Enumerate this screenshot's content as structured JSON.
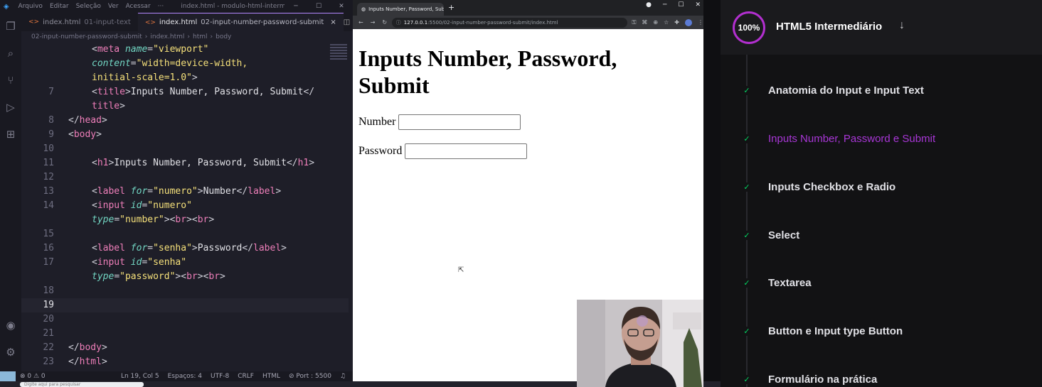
{
  "vscode": {
    "menu": [
      "Arquivo",
      "Editar",
      "Seleção",
      "Ver",
      "Acessar",
      "···"
    ],
    "window_title": "index.html - modulo-html-intermedi...",
    "tabs": [
      {
        "name": "index.html",
        "sub": "01-input-text",
        "active": false
      },
      {
        "name": "index.html",
        "sub": "02-input-number-password-submit",
        "active": true,
        "close": "×"
      }
    ],
    "breadcrumb": [
      "02-input-number-password-submit",
      "›",
      "index.html",
      "›",
      "html",
      "›",
      "body"
    ],
    "lines": [
      {
        "n": "",
        "html": "<span class='pu'>&lt;</span><span class='tg'>meta</span> <span class='at'>name</span><span class='pu'>=</span><span class='st'>\"viewport\"</span>"
      },
      {
        "n": "",
        "html": "<span class='at'>content</span><span class='pu'>=</span><span class='st'>\"width=device-width,</span>"
      },
      {
        "n": "",
        "html": "<span class='st'>initial-scale=1.0\"</span><span class='pu'>&gt;</span>"
      },
      {
        "n": "7",
        "html": "<span class='pu'>&lt;</span><span class='tg'>title</span><span class='pu'>&gt;</span><span class='t'>Inputs Number, Password, Submit</span><span class='pu'>&lt;/</span>"
      },
      {
        "n": "",
        "html": "<span class='tg'>title</span><span class='pu'>&gt;</span>"
      },
      {
        "n": "8",
        "html": "<span class='pu'>&lt;/</span><span class='tg'>head</span><span class='pu'>&gt;</span>"
      },
      {
        "n": "9",
        "html": "<span class='pu'>&lt;</span><span class='tg'>body</span><span class='pu'>&gt;</span>"
      },
      {
        "n": "10",
        "html": ""
      },
      {
        "n": "11",
        "html": "<span class='pu'>&lt;</span><span class='tg'>h1</span><span class='pu'>&gt;</span><span class='t'>Inputs Number, Password, Submit</span><span class='pu'>&lt;/</span><span class='tg'>h1</span><span class='pu'>&gt;</span>"
      },
      {
        "n": "12",
        "html": ""
      },
      {
        "n": "13",
        "html": "<span class='pu'>&lt;</span><span class='tg'>label</span> <span class='at'>for</span><span class='pu'>=</span><span class='st'>\"numero\"</span><span class='pu'>&gt;</span><span class='t'>Number</span><span class='pu'>&lt;/</span><span class='tg'>label</span><span class='pu'>&gt;</span>"
      },
      {
        "n": "14",
        "html": "<span class='pu'>&lt;</span><span class='tg'>input</span> <span class='at'>id</span><span class='pu'>=</span><span class='st'>\"numero\"</span>"
      },
      {
        "n": "",
        "html": "<span class='at'>type</span><span class='pu'>=</span><span class='st'>\"number\"</span><span class='pu'>&gt;&lt;</span><span class='tg'>br</span><span class='pu'>&gt;&lt;</span><span class='tg'>br</span><span class='pu'>&gt;</span>"
      },
      {
        "n": "15",
        "html": ""
      },
      {
        "n": "16",
        "html": "<span class='pu'>&lt;</span><span class='tg'>label</span> <span class='at'>for</span><span class='pu'>=</span><span class='st'>\"senha\"</span><span class='pu'>&gt;</span><span class='t'>Password</span><span class='pu'>&lt;/</span><span class='tg'>label</span><span class='pu'>&gt;</span>"
      },
      {
        "n": "17",
        "html": "<span class='pu'>&lt;</span><span class='tg'>input</span> <span class='at'>id</span><span class='pu'>=</span><span class='st'>\"senha\"</span>"
      },
      {
        "n": "",
        "html": "<span class='at'>type</span><span class='pu'>=</span><span class='st'>\"password\"</span><span class='pu'>&gt;&lt;</span><span class='tg'>br</span><span class='pu'>&gt;&lt;</span><span class='tg'>br</span><span class='pu'>&gt;</span>"
      },
      {
        "n": "18",
        "html": ""
      },
      {
        "n": "19",
        "html": "",
        "current": true
      },
      {
        "n": "20",
        "html": ""
      },
      {
        "n": "21",
        "html": ""
      },
      {
        "n": "22",
        "html": "<span class='pu'>&lt;/</span><span class='tg'>body</span><span class='pu'>&gt;</span>"
      },
      {
        "n": "23",
        "html": "<span class='pu'>&lt;/</span><span class='tg'>html</span><span class='pu'>&gt;</span>"
      }
    ],
    "status": {
      "problems": "⊗ 0 ⚠ 0",
      "position": "Ln 19, Col 5",
      "spaces": "Espaços: 4",
      "encoding": "UTF-8",
      "eol": "CRLF",
      "language": "HTML",
      "port": "⊘ Port : 5500"
    },
    "taskbar_search": "Digite aqui para pesquisar"
  },
  "browser": {
    "tab_title": "Inputs Number, Password, Submit",
    "new_tab": "+",
    "url_host": "127.0.0.1",
    "url_path": ":5500/02-input-number-password-submit/index.html",
    "page": {
      "heading": "Inputs Number, Password, Submit",
      "number_label": "Number",
      "password_label": "Password",
      "number_value": "",
      "password_value": ""
    }
  },
  "course": {
    "progress": "100%",
    "title": "HTML5 Intermediário",
    "arrow": "↓",
    "accent": "#a836d6",
    "check_color": "#04d361",
    "lessons": [
      {
        "label": "Anatomia do Input e Input Text",
        "current": false
      },
      {
        "label": "Inputs Number, Password e Submit",
        "current": true
      },
      {
        "label": "Inputs Checkbox e Radio",
        "current": false
      },
      {
        "label": "Select",
        "current": false
      },
      {
        "label": "Textarea",
        "current": false
      },
      {
        "label": "Button e Input type Button",
        "current": false
      },
      {
        "label": "Formulário na prática",
        "current": false
      }
    ]
  }
}
